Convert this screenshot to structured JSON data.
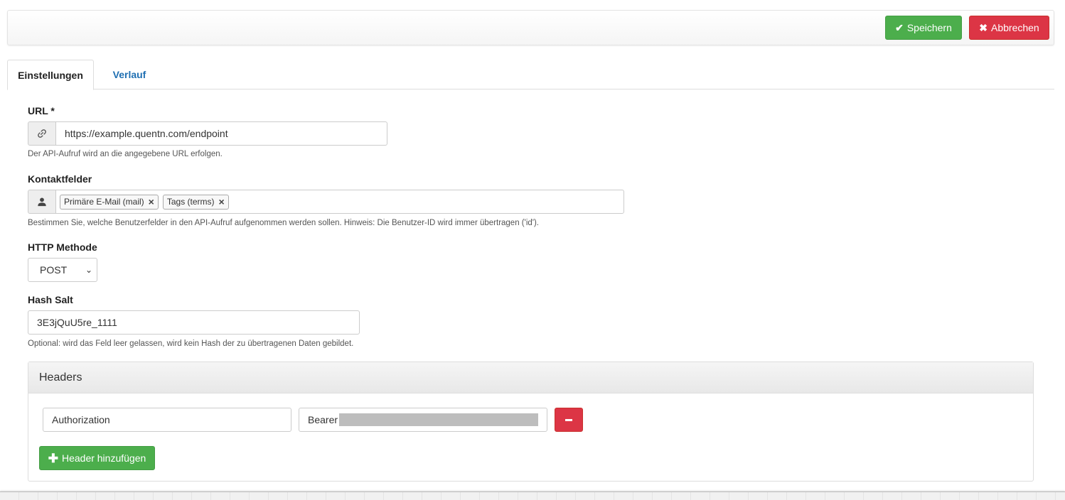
{
  "toolbar": {
    "save_label": "Speichern",
    "cancel_label": "Abbrechen"
  },
  "tabs": [
    {
      "label": "Einstellungen",
      "active": true
    },
    {
      "label": "Verlauf",
      "active": false
    }
  ],
  "url": {
    "label": "URL *",
    "value": "https://example.quentn.com/endpoint",
    "help": "Der API-Aufruf wird an die angegebene URL erfolgen.",
    "icon": "link-icon"
  },
  "contact_fields": {
    "label": "Kontaktfelder",
    "icon": "user-icon",
    "selected": [
      "Primäre E-Mail (mail)",
      "Tags (terms)"
    ],
    "help": "Bestimmen Sie, welche Benutzerfelder in den API-Aufruf aufgenommen werden sollen. Hinweis: Die Benutzer-ID wird immer übertragen ('id')."
  },
  "http_method": {
    "label": "HTTP Methode",
    "value": "POST"
  },
  "hash_salt": {
    "label": "Hash Salt",
    "value": "3E3jQuU5re_1111",
    "help": "Optional: wird das Feld leer gelassen, wird kein Hash der zu übertragenen Daten gebildet."
  },
  "headers": {
    "title": "Headers",
    "rows": [
      {
        "key": "Authorization",
        "value": "Bearer"
      }
    ],
    "add_label": "Header hinzufügen"
  },
  "colors": {
    "success": "#4cae4c",
    "danger": "#dc3545",
    "link": "#1f6fb2"
  }
}
